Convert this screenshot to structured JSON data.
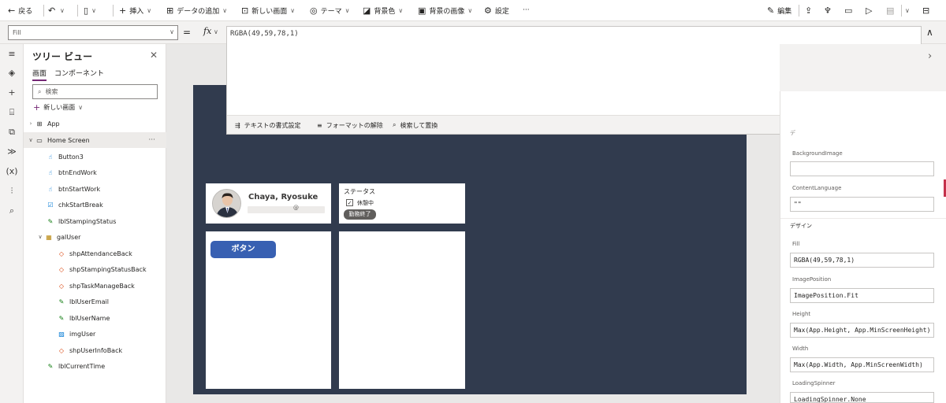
{
  "toolbar": {
    "back": "戻る",
    "insert": "挿入",
    "add_data": "データの追加",
    "new_screen": "新しい画面",
    "theme": "テーマ",
    "background_color": "背景色",
    "background_image": "背景の画像",
    "settings": "設定",
    "more": "···",
    "edit": "編集"
  },
  "formula_bar": {
    "property": "Fill",
    "equals": "=",
    "fx": "fx",
    "formula": "RGBA(49,59,78,1)",
    "format_text": "テキストの書式設定",
    "remove_formatting": "フォーマットの解除",
    "find_replace": "検索して置換"
  },
  "tree": {
    "title": "ツリー ビュー",
    "tabs": [
      "画面",
      "コンポーネント"
    ],
    "search_placeholder": "検索",
    "new_screen": "新しい画面",
    "nodes": [
      {
        "label": "App"
      },
      {
        "label": "Home Screen"
      },
      {
        "label": "Button3"
      },
      {
        "label": "btnEndWork"
      },
      {
        "label": "btnStartWork"
      },
      {
        "label": "chkStartBreak"
      },
      {
        "label": "lblStampingStatus"
      },
      {
        "label": "galUser"
      },
      {
        "label": "shpAttendanceBack"
      },
      {
        "label": "shpStampingStatusBack"
      },
      {
        "label": "shpTaskManageBack"
      },
      {
        "label": "lblUserEmail"
      },
      {
        "label": "lblUserName"
      },
      {
        "label": "imgUser"
      },
      {
        "label": "shpUserInfoBack"
      },
      {
        "label": "lblCurrentTime"
      }
    ]
  },
  "canvas": {
    "screen_fill": "#313b4e",
    "user_name": "Chaya, Ryosuke",
    "email_at": "@",
    "status_label": "ステータス",
    "break_checkbox": "休憩中",
    "end_work_button": "勤務終了",
    "button3": "ボタン"
  },
  "properties": {
    "partial_heading": "デ",
    "background_image_label": "BackgroundImage",
    "background_image_value": "",
    "content_language_label": "ContentLanguage",
    "content_language_value": "\"\"",
    "design_heading": "デザイン",
    "fill_label": "Fill",
    "fill_value": "RGBA(49,59,78,1)",
    "image_position_label": "ImagePosition",
    "image_position_value": "ImagePosition.Fit",
    "height_label": "Height",
    "height_value": "Max(App.Height, App.MinScreenHeight)",
    "width_label": "Width",
    "width_value": "Max(App.Width, App.MinScreenWidth)",
    "loading_spinner_label": "LoadingSpinner",
    "loading_spinner_value": "LoadingSpinner.None"
  },
  "colors": {
    "accent": "#742774",
    "button_blue": "#3860b2",
    "screen": "#313b4e"
  }
}
